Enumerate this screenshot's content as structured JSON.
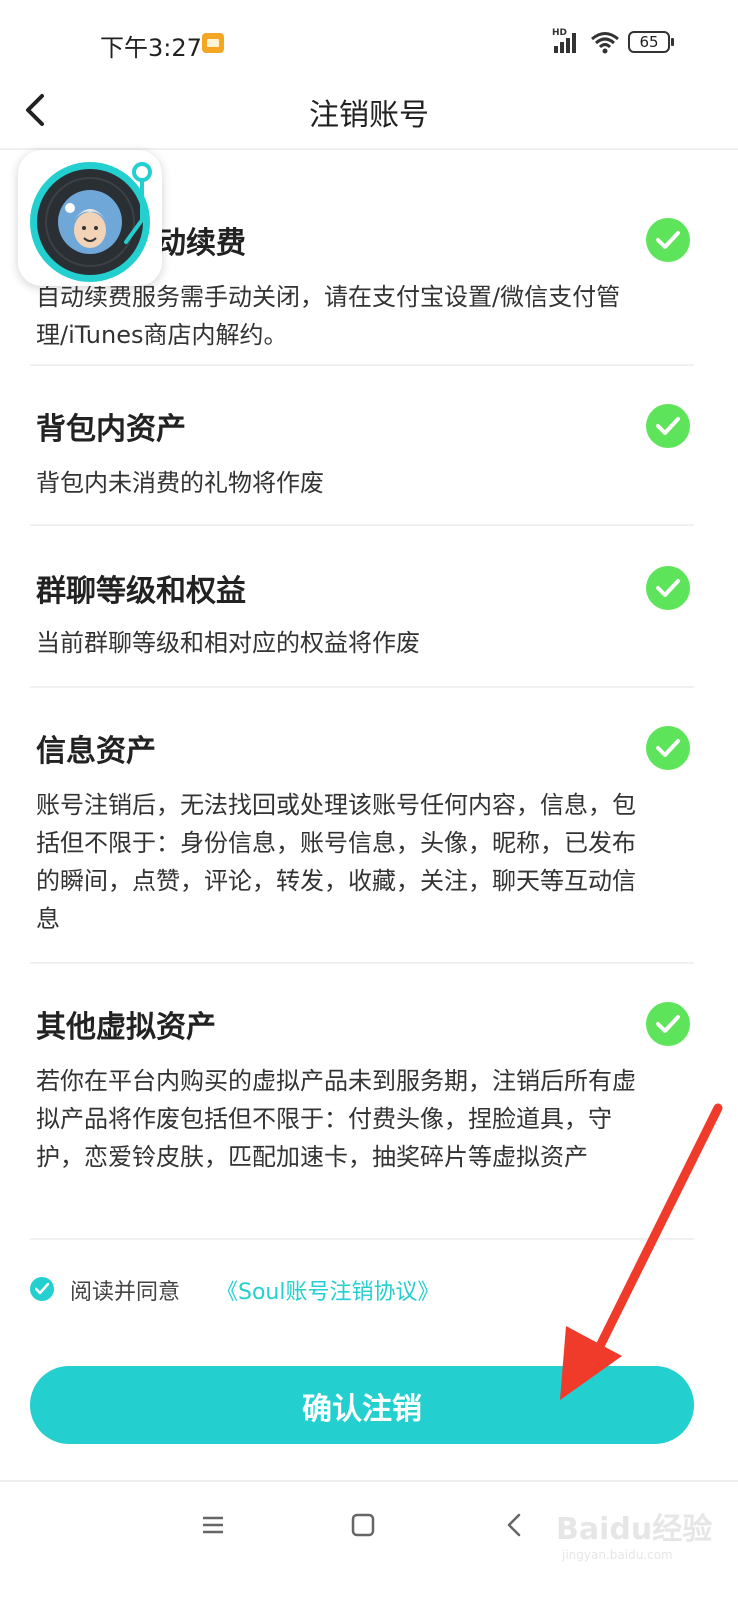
{
  "status_bar": {
    "time": "下午3:27",
    "network": "HD",
    "battery": "65"
  },
  "header": {
    "title": "注销账号"
  },
  "items": [
    {
      "title": "服务和自动续费",
      "desc": "自动续费服务需手动关闭，请在支付宝设置/微信支付管理/iTunes商店内解约。",
      "checked": true
    },
    {
      "title": "背包内资产",
      "desc": "背包内未消费的礼物将作废",
      "checked": true
    },
    {
      "title": "群聊等级和权益",
      "desc": "当前群聊等级和相对应的权益将作废",
      "checked": true
    },
    {
      "title": "信息资产",
      "desc": "账号注销后，无法找回或处理该账号任何内容，信息，包括但不限于：身份信息，账号信息，头像，昵称，已发布的瞬间，点赞，评论，转发，收藏，关注，聊天等互动信息",
      "checked": true
    },
    {
      "title": "其他虚拟资产",
      "desc": "若你在平台内购买的虚拟产品未到服务期，注销后所有虚拟产品将作废包括但不限于：付费头像，捏脸道具，守护，恋爱铃皮肤，匹配加速卡，抽奖碎片等虚拟资产",
      "checked": true
    }
  ],
  "agreement": {
    "checked": true,
    "text": "阅读并同意",
    "link": "《Soul账号注销协议》"
  },
  "confirm_button": {
    "label": "确认注销"
  },
  "watermark": {
    "logo": "Baidu经验",
    "sub": "jingyan.baidu.com"
  },
  "colors": {
    "accent": "#23cfcf",
    "check_green": "#5ee45a",
    "arrow_red": "#f03a2a"
  }
}
